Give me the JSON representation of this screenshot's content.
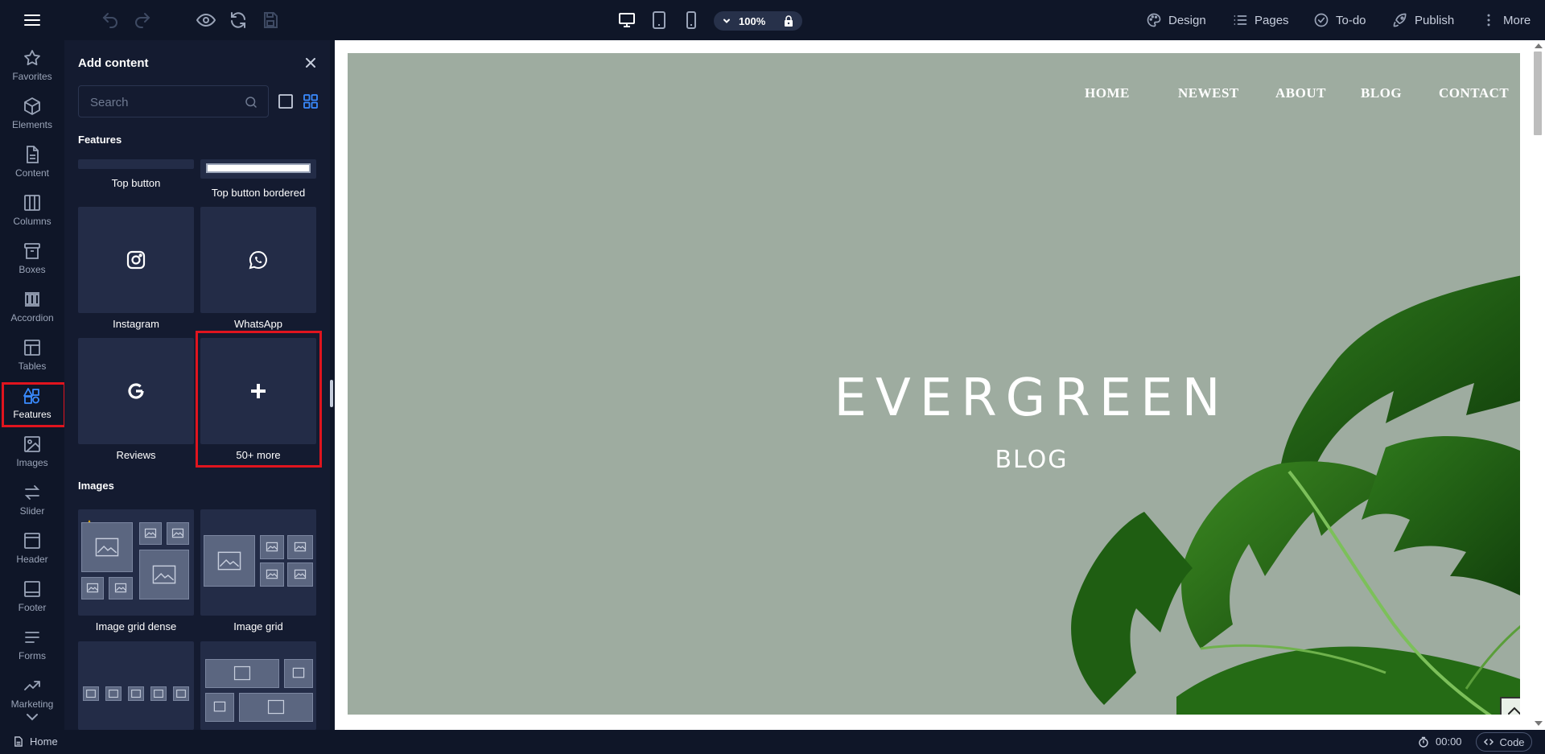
{
  "toolbar": {
    "zoom_value": "100%",
    "menu": [
      {
        "label": "Design",
        "icon": "palette-icon"
      },
      {
        "label": "Pages",
        "icon": "list-icon"
      },
      {
        "label": "To-do",
        "icon": "check-circle-icon"
      },
      {
        "label": "Publish",
        "icon": "rocket-icon"
      },
      {
        "label": "More",
        "icon": "more-vertical-icon"
      }
    ]
  },
  "sidebar": {
    "items": [
      {
        "label": "Favorites",
        "icon": "star-icon"
      },
      {
        "label": "Elements",
        "icon": "cube-icon"
      },
      {
        "label": "Content",
        "icon": "document-icon"
      },
      {
        "label": "Columns",
        "icon": "columns-icon"
      },
      {
        "label": "Boxes",
        "icon": "box-icon"
      },
      {
        "label": "Accordion",
        "icon": "accordion-icon"
      },
      {
        "label": "Tables",
        "icon": "table-icon"
      },
      {
        "label": "Features",
        "icon": "features-icon",
        "active": true
      },
      {
        "label": "Images",
        "icon": "image-icon"
      },
      {
        "label": "Slider",
        "icon": "slider-icon"
      },
      {
        "label": "Header",
        "icon": "header-icon"
      },
      {
        "label": "Footer",
        "icon": "footer-icon"
      },
      {
        "label": "Forms",
        "icon": "forms-icon"
      },
      {
        "label": "Marketing",
        "icon": "trend-icon"
      }
    ]
  },
  "panel": {
    "title": "Add content",
    "search_placeholder": "Search",
    "section_features": "Features",
    "section_images": "Images",
    "tiles": {
      "top_button": "Top button",
      "top_button_bordered": "Top button bordered",
      "instagram": "Instagram",
      "whatsapp": "WhatsApp",
      "reviews": "Reviews",
      "more": "50+ more",
      "image_grid_dense": "Image grid dense",
      "image_grid": "Image grid"
    }
  },
  "site": {
    "nav": [
      "HOME",
      "NEWEST",
      "ABOUT",
      "BLOG",
      "CONTACT"
    ],
    "title": "EVERGREEN",
    "subtitle": "BLOG"
  },
  "status": {
    "page": "Home",
    "timer": "00:00",
    "code_label": "Code"
  },
  "colors": {
    "accent": "#3a8bff",
    "highlight": "#e0141e",
    "hero_bg": "#9eaca0",
    "panel_bg": "#141b30",
    "app_bg": "#0f1628"
  }
}
